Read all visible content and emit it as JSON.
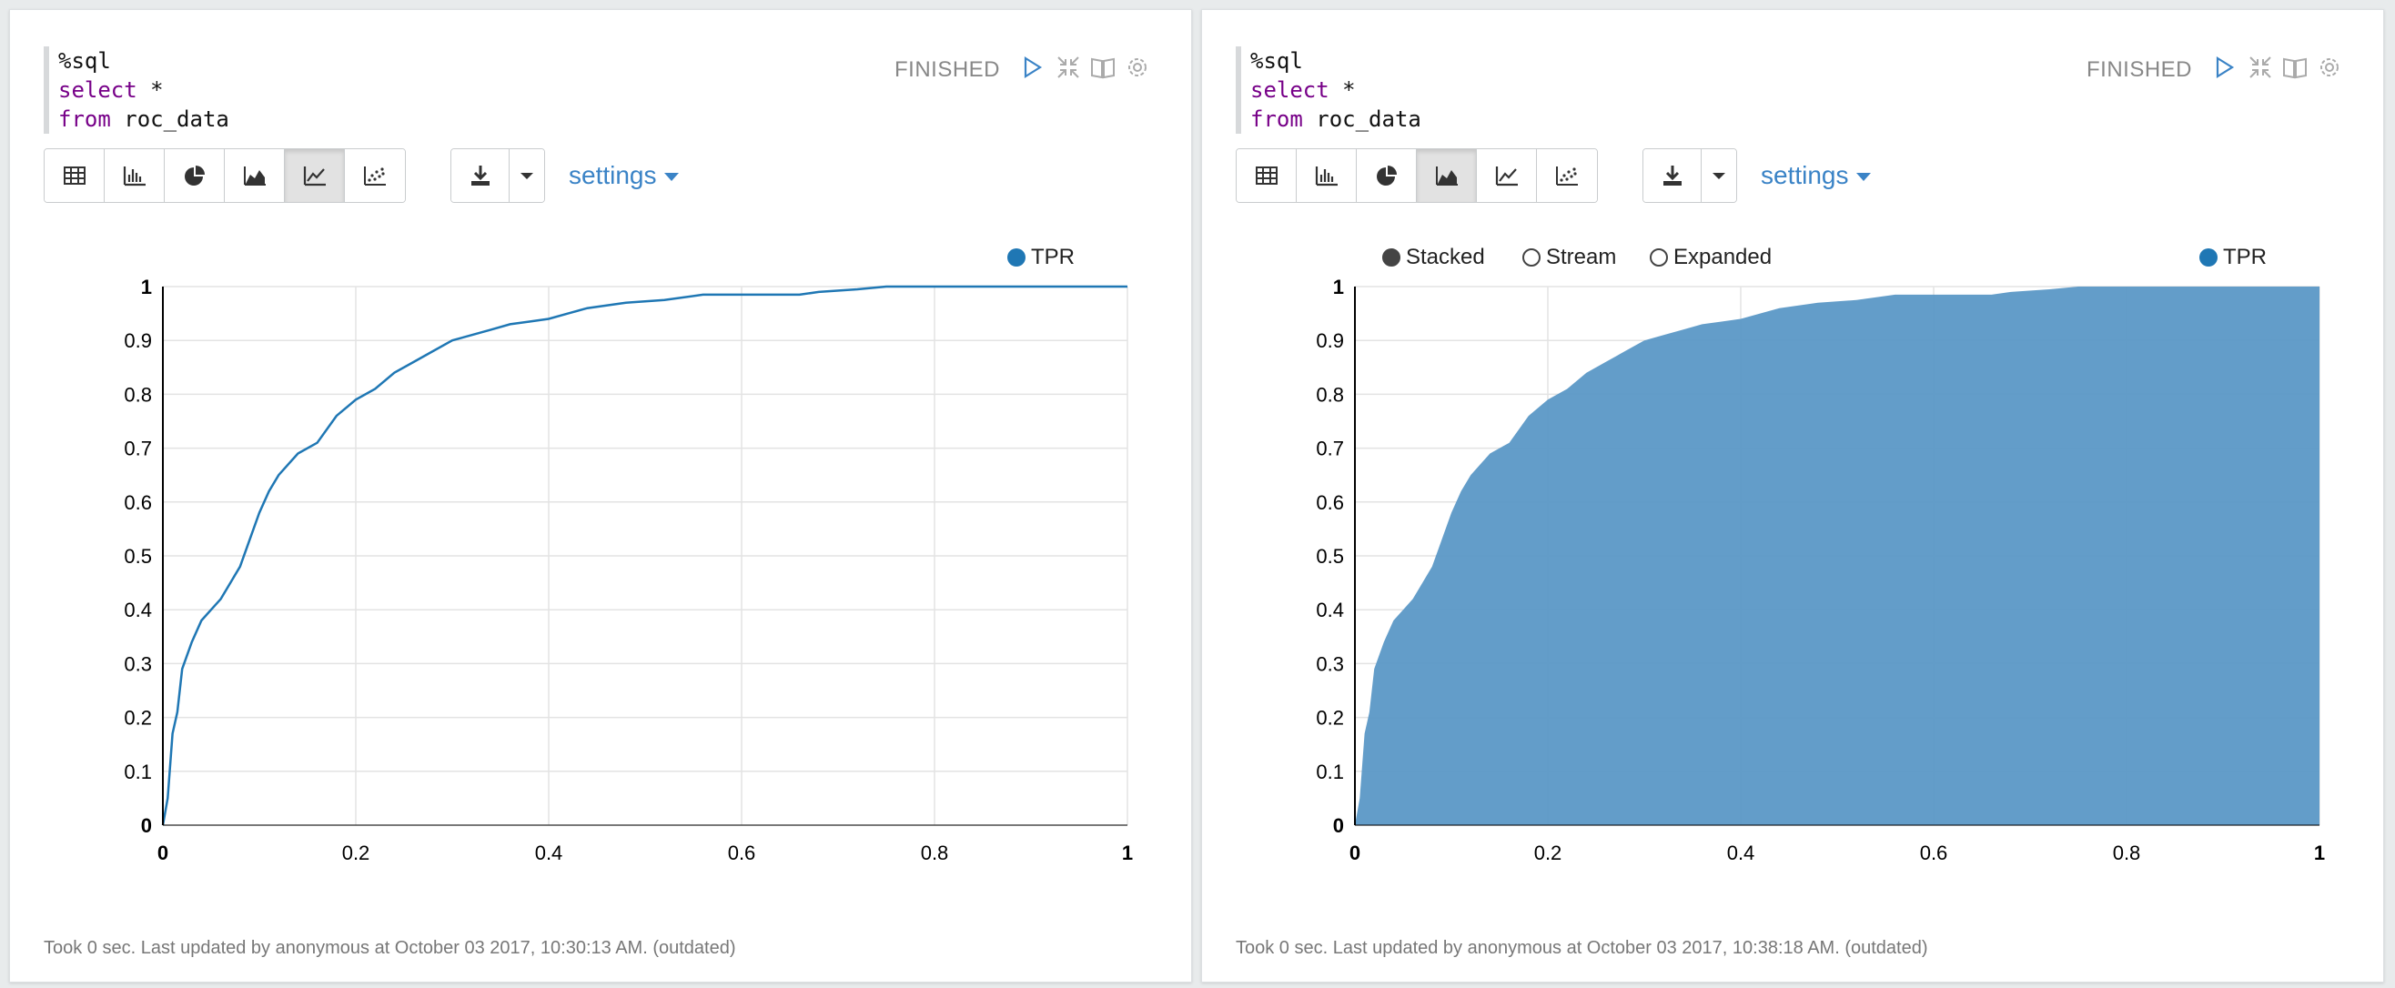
{
  "colors": {
    "accent": "#3a83c6",
    "series_line": "#1f77b4",
    "series_area": "#5b98c6"
  },
  "panels": [
    {
      "code": {
        "line1": "%sql",
        "kw_select": "select",
        "select_rest": " *",
        "kw_from": "from",
        "from_rest": " roc_data"
      },
      "status": "FINISHED",
      "settings_label": "settings",
      "legend": {
        "series": "TPR"
      },
      "footer": "Took 0 sec. Last updated by anonymous at October 03 2017, 10:30:13 AM. (outdated)",
      "active_chart_button": "line"
    },
    {
      "code": {
        "line1": "%sql",
        "kw_select": "select",
        "select_rest": " *",
        "kw_from": "from",
        "from_rest": " roc_data"
      },
      "status": "FINISHED",
      "settings_label": "settings",
      "legend": {
        "series": "TPR"
      },
      "stack_options": {
        "stacked": "Stacked",
        "stream": "Stream",
        "expanded": "Expanded",
        "selected": "Stacked"
      },
      "footer": "Took 0 sec. Last updated by anonymous at October 03 2017, 10:38:18 AM. (outdated)",
      "active_chart_button": "area"
    }
  ],
  "chart_data": [
    {
      "type": "line",
      "series": [
        {
          "name": "TPR",
          "points": [
            [
              0,
              0
            ],
            [
              0.005,
              0.05
            ],
            [
              0.01,
              0.17
            ],
            [
              0.015,
              0.21
            ],
            [
              0.02,
              0.29
            ],
            [
              0.03,
              0.34
            ],
            [
              0.04,
              0.38
            ],
            [
              0.05,
              0.4
            ],
            [
              0.06,
              0.42
            ],
            [
              0.07,
              0.45
            ],
            [
              0.08,
              0.48
            ],
            [
              0.09,
              0.53
            ],
            [
              0.1,
              0.58
            ],
            [
              0.11,
              0.62
            ],
            [
              0.12,
              0.65
            ],
            [
              0.14,
              0.69
            ],
            [
              0.16,
              0.71
            ],
            [
              0.18,
              0.76
            ],
            [
              0.2,
              0.79
            ],
            [
              0.22,
              0.81
            ],
            [
              0.24,
              0.84
            ],
            [
              0.26,
              0.86
            ],
            [
              0.28,
              0.88
            ],
            [
              0.3,
              0.9
            ],
            [
              0.32,
              0.91
            ],
            [
              0.34,
              0.92
            ],
            [
              0.36,
              0.93
            ],
            [
              0.38,
              0.935
            ],
            [
              0.4,
              0.94
            ],
            [
              0.42,
              0.95
            ],
            [
              0.44,
              0.96
            ],
            [
              0.48,
              0.97
            ],
            [
              0.52,
              0.975
            ],
            [
              0.56,
              0.985
            ],
            [
              0.6,
              0.985
            ],
            [
              0.66,
              0.985
            ],
            [
              0.68,
              0.99
            ],
            [
              0.72,
              0.995
            ],
            [
              0.75,
              1
            ],
            [
              1,
              1
            ]
          ]
        }
      ],
      "x_ticks": [
        "0",
        "0.2",
        "0.4",
        "0.6",
        "0.8",
        "1"
      ],
      "y_ticks": [
        "0",
        "0.1",
        "0.2",
        "0.3",
        "0.4",
        "0.5",
        "0.6",
        "0.7",
        "0.8",
        "0.9",
        "1"
      ],
      "xlim": [
        0,
        1
      ],
      "ylim": [
        0,
        1
      ],
      "grid": true,
      "legend_position": "top-right"
    },
    {
      "type": "area",
      "series": [
        {
          "name": "TPR",
          "points": [
            [
              0,
              0
            ],
            [
              0.005,
              0.05
            ],
            [
              0.01,
              0.17
            ],
            [
              0.015,
              0.21
            ],
            [
              0.02,
              0.29
            ],
            [
              0.03,
              0.34
            ],
            [
              0.04,
              0.38
            ],
            [
              0.05,
              0.4
            ],
            [
              0.06,
              0.42
            ],
            [
              0.07,
              0.45
            ],
            [
              0.08,
              0.48
            ],
            [
              0.09,
              0.53
            ],
            [
              0.1,
              0.58
            ],
            [
              0.11,
              0.62
            ],
            [
              0.12,
              0.65
            ],
            [
              0.14,
              0.69
            ],
            [
              0.16,
              0.71
            ],
            [
              0.18,
              0.76
            ],
            [
              0.2,
              0.79
            ],
            [
              0.22,
              0.81
            ],
            [
              0.24,
              0.84
            ],
            [
              0.26,
              0.86
            ],
            [
              0.28,
              0.88
            ],
            [
              0.3,
              0.9
            ],
            [
              0.32,
              0.91
            ],
            [
              0.34,
              0.92
            ],
            [
              0.36,
              0.93
            ],
            [
              0.38,
              0.935
            ],
            [
              0.4,
              0.94
            ],
            [
              0.42,
              0.95
            ],
            [
              0.44,
              0.96
            ],
            [
              0.48,
              0.97
            ],
            [
              0.52,
              0.975
            ],
            [
              0.56,
              0.985
            ],
            [
              0.6,
              0.985
            ],
            [
              0.66,
              0.985
            ],
            [
              0.68,
              0.99
            ],
            [
              0.72,
              0.995
            ],
            [
              0.75,
              1
            ],
            [
              1,
              1
            ]
          ]
        }
      ],
      "x_ticks": [
        "0",
        "0.2",
        "0.4",
        "0.6",
        "0.8",
        "1"
      ],
      "y_ticks": [
        "0",
        "0.1",
        "0.2",
        "0.3",
        "0.4",
        "0.5",
        "0.6",
        "0.7",
        "0.8",
        "0.9",
        "1"
      ],
      "xlim": [
        0,
        1
      ],
      "ylim": [
        0,
        1
      ],
      "grid": true,
      "stacked": true,
      "legend_position": "top-right"
    }
  ]
}
